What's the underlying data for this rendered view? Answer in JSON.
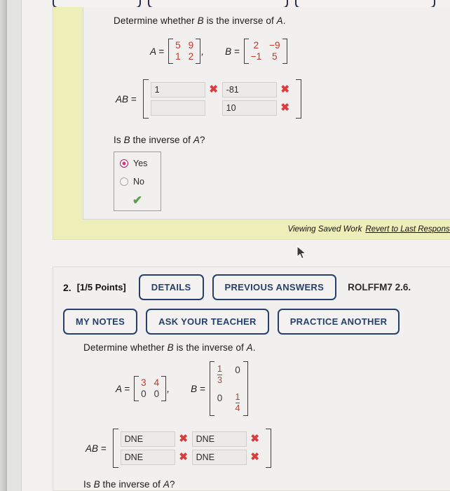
{
  "top_partial_buttons": [
    "",
    "",
    ""
  ],
  "question1": {
    "prompt_pre": "Determine whether ",
    "prompt_var_b": "B",
    "prompt_mid": " is the inverse of ",
    "prompt_var_a": "A",
    "prompt_end": ".",
    "matrix_a": {
      "label": "A =",
      "values": [
        [
          "5",
          "9"
        ],
        [
          "1",
          "2"
        ]
      ],
      "color": "#c0392b"
    },
    "matrix_b": {
      "label": "B =",
      "values": [
        [
          "2",
          "−9"
        ],
        [
          "−1",
          "5"
        ]
      ],
      "color": "#c0392b"
    },
    "comma": ",",
    "product": {
      "label": "AB =",
      "cells": [
        [
          {
            "value": "1",
            "mark": "✖"
          },
          {
            "value": "-81",
            "mark": "✖"
          }
        ],
        [
          {
            "value": "",
            "mark": ""
          },
          {
            "value": "10",
            "mark": "✖"
          }
        ]
      ]
    },
    "question_text_pre": "Is ",
    "question_text_b": "B",
    "question_text_mid": " the inverse of ",
    "question_text_a": "A",
    "question_text_end": "?",
    "options": [
      {
        "label": "Yes",
        "selected": true
      },
      {
        "label": "No",
        "selected": false
      }
    ],
    "correct_mark": "✔",
    "saved_work_text": "Viewing Saved Work",
    "revert_link": "Revert to Last Response"
  },
  "question2": {
    "number": "2.",
    "points": "[1/5 Points]",
    "details_button": "DETAILS",
    "previous_answers_button": "PREVIOUS ANSWERS",
    "code": "ROLFFM7 2.6.",
    "my_notes_button": "MY NOTES",
    "ask_teacher_button": "ASK YOUR TEACHER",
    "practice_another_button": "PRACTICE ANOTHER",
    "prompt_pre": "Determine whether ",
    "prompt_var_b": "B",
    "prompt_mid": " is the inverse of ",
    "prompt_var_a": "A",
    "prompt_end": ".",
    "matrix_a": {
      "label": "A =",
      "values": [
        [
          "3",
          "4"
        ],
        [
          "0",
          "0"
        ]
      ]
    },
    "matrix_b": {
      "label": "B =",
      "cells": [
        [
          {
            "type": "fraction",
            "num": "1",
            "den": "3"
          },
          {
            "type": "plain",
            "value": "0"
          }
        ],
        [
          {
            "type": "plain",
            "value": "0"
          },
          {
            "type": "fraction",
            "num": "1",
            "den": "4"
          }
        ]
      ]
    },
    "comma": ",",
    "product": {
      "label": "AB =",
      "cells": [
        [
          {
            "value": "DNE",
            "mark": "✖"
          },
          {
            "value": "DNE",
            "mark": "✖"
          }
        ],
        [
          {
            "value": "DNE",
            "mark": "✖"
          },
          {
            "value": "DNE",
            "mark": "✖"
          }
        ]
      ]
    },
    "question_text_pre": "Is ",
    "question_text_b": "B",
    "question_text_mid": " the inverse of ",
    "question_text_a": "A",
    "question_text_end": "?"
  },
  "colors": {
    "matrix_red": "#c0392b",
    "x_mark_red": "#dc3c3c",
    "check_green": "#59a14f",
    "radio_selected": "#d6367f",
    "button_blue": "#27406b",
    "saved_yellow": "#eeeeb9"
  }
}
